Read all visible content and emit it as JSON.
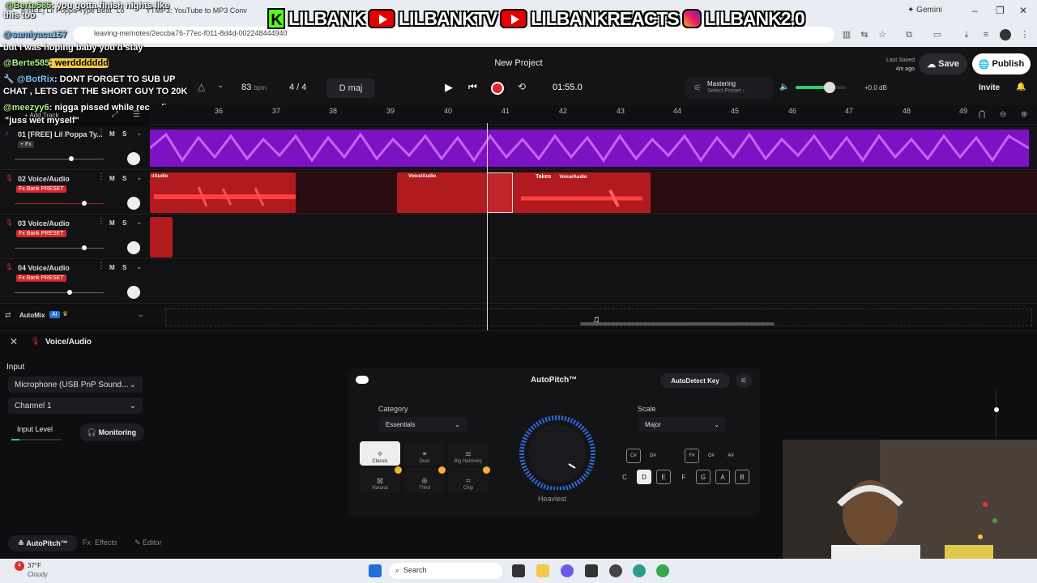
{
  "browser": {
    "tabs": [
      "[FREE] Lil Poppa Type Beat \"Lo",
      "YTMP3: YouTube to MP3 Conv"
    ],
    "url": "leaving-me/notes/2eccba76-77ec-f011-8d4d-002248444940",
    "gemini": "Gemini",
    "banner": {
      "part1": "LILBANK",
      "part2": "LILBANKTV",
      "part3": "LILBANKREACTS",
      "part4": "LILBANK2.0"
    }
  },
  "chat": [
    {
      "user": "@Berte585",
      "text": ": you gotta finish nights like"
    },
    {
      "user": "",
      "text": "this too"
    },
    {
      "user": "@samiyaca157",
      "text": ""
    },
    {
      "user": "",
      "text": "but I was hoping baby you'd stay"
    },
    {
      "user": "@Berte585",
      "text": ": werddddddd"
    },
    {
      "user": "@BotRix",
      "text": ": DONT FORGET TO SUB UP"
    },
    {
      "user": "",
      "text": "CHAT , LETS GET THE SHORT GUY TO 20K"
    },
    {
      "user": "@meezyy6",
      "text": ": nigga pissed while recording"
    },
    {
      "user": "",
      "text": "\"juss wet myself\""
    }
  ],
  "project": {
    "title": "New Project",
    "last_saved_label": "Last Saved",
    "last_saved_value": "4m ago",
    "save": "Save",
    "publish": "Publish",
    "invite": "Invite"
  },
  "transport": {
    "bpm": "83",
    "bpm_unit": "bpm",
    "time_sig": "4 / 4",
    "key": "D maj",
    "time": "01:55.0",
    "mastering": "Mastering",
    "preset": "Select Preset",
    "gain": "+0.0 dB"
  },
  "ruler": [
    "36",
    "37",
    "38",
    "39",
    "40",
    "41",
    "42",
    "43",
    "44",
    "45",
    "46",
    "47",
    "48",
    "49"
  ],
  "add_track": "Add Track",
  "tracks": [
    {
      "name": "01  [FREE] Lil Poppa Ty...",
      "badge": "+ Fx",
      "m": "M",
      "s": "S"
    },
    {
      "name": "02  Voice/Audio",
      "badge": "Fx Bank PRESET",
      "m": "M",
      "s": "S"
    },
    {
      "name": "03  Voice/Audio",
      "badge": "Fx Bank PRESET",
      "m": "M",
      "s": "S"
    },
    {
      "name": "04  Voice/Audio",
      "badge": "Fx Bank PRESET",
      "m": "M",
      "s": "S"
    }
  ],
  "clips": {
    "c1": "ı/Audio",
    "c2": "Voice/Audio",
    "c3": "Takes",
    "c4": "Voice/Audio"
  },
  "automix": {
    "label": "AutoMix",
    "ai": "AI"
  },
  "panel": {
    "title": "Voice/Audio",
    "input_label": "Input",
    "mic": "Microphone (USB PnP Sound...",
    "channel": "Channel 1",
    "input_level": "Input Level",
    "monitoring": "Monitoring",
    "autopitch_title": "AutoPitch™",
    "autodetect": "AutoDetect Key",
    "category_label": "Category",
    "category_value": "Essentials",
    "scale_label": "Scale",
    "scale_value": "Major",
    "knob_label": "Heaviest",
    "styles": [
      "Classic",
      "Duet",
      "Big Harmony",
      "Natural",
      "Third",
      "Chip"
    ],
    "sharps": [
      [
        "C#",
        "Db"
      ],
      [
        "D#",
        "Eb"
      ],
      [
        "F#",
        "Gb"
      ],
      [
        "G#",
        "Ab"
      ],
      [
        "A#",
        "Bb"
      ]
    ],
    "naturals": [
      "C",
      "D",
      "E",
      "F",
      "G",
      "A",
      "B"
    ],
    "tabs": [
      "AutoPitch™",
      "Effects",
      "Editor"
    ]
  },
  "taskbar": {
    "temp": "37°F",
    "weather": "Cloudy",
    "search": "Search",
    "notif_count": "4"
  },
  "colors": {
    "accent_purple": "#a020f0",
    "clip_red": "#b11a1e",
    "record_red": "#e0262c"
  }
}
